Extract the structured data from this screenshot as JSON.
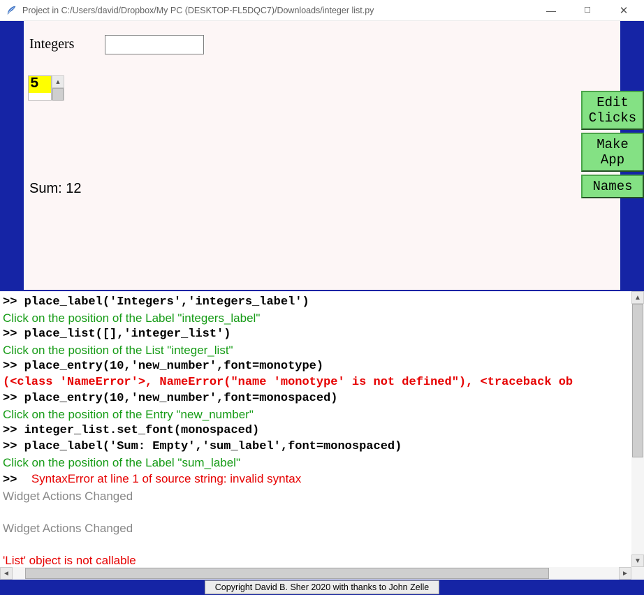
{
  "window": {
    "title": "Project in C:/Users/david/Dropbox/My PC (DESKTOP-FL5DQC7)/Downloads/integer list.py"
  },
  "upper": {
    "integers_label": "Integers",
    "entry_value": "",
    "list_items": [
      "5"
    ],
    "sum_label": "Sum: 12",
    "buttons": {
      "edit_clicks": "Edit\nClicks",
      "make_app": "Make\nApp",
      "names": "Names"
    }
  },
  "console": [
    {
      "cls": "mono c-black",
      "text": ">> place_label('Integers','integers_label')"
    },
    {
      "cls": "c-green",
      "text": "Click on the position of the Label \"integers_label\""
    },
    {
      "cls": "mono c-black",
      "text": ">> place_list([],'integer_list')"
    },
    {
      "cls": "c-green",
      "text": "Click on the position of the List \"integer_list\""
    },
    {
      "cls": "mono c-black",
      "text": ">> place_entry(10,'new_number',font=monotype)"
    },
    {
      "cls": "mono c-red",
      "text": "(<class 'NameError'>, NameError(\"name 'monotype' is not defined\"), <traceback ob"
    },
    {
      "cls": "mono c-black",
      "text": ">> place_entry(10,'new_number',font=monospaced)"
    },
    {
      "cls": "c-green",
      "text": "Click on the position of the Entry \"new_number\""
    },
    {
      "cls": "mono c-black",
      "text": ">> integer_list.set_font(monospaced)"
    },
    {
      "cls": "mono c-black",
      "text": ">> place_label('Sum: Empty','sum_label',font=monospaced)"
    },
    {
      "cls": "c-green",
      "text": "Click on the position of the Label \"sum_label\""
    },
    {
      "cls": "mixed",
      "prefix": ">>  ",
      "text": "SyntaxError at line 1 of source string: invalid syntax"
    },
    {
      "cls": "c-gray",
      "text": "Widget Actions Changed"
    },
    {
      "cls": "c-gray",
      "text": " "
    },
    {
      "cls": "c-gray",
      "text": "Widget Actions Changed"
    },
    {
      "cls": "c-gray",
      "text": " "
    },
    {
      "cls": "c-red-sans",
      "text": "'List' object is not callable"
    }
  ],
  "footer": {
    "copyright": "Copyright David B. Sher 2020 with thanks to John Zelle"
  }
}
